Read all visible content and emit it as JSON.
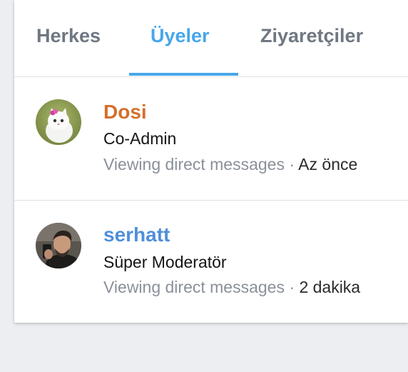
{
  "tabs": {
    "everyone": "Herkes",
    "members": "Üyeler",
    "visitors": "Ziyaretçiler",
    "active": "members"
  },
  "members": [
    {
      "name": "Dosi",
      "name_color": "#d56f2c",
      "role": "Co-Admin",
      "activity": "Viewing direct messages",
      "separator": "·",
      "time": "Az önce",
      "avatar_icon": "white-kitten-avatar"
    },
    {
      "name": "serhatt",
      "name_color": "#4f8fd9",
      "role": "Süper Moderatör",
      "activity": "Viewing direct messages",
      "separator": "·",
      "time": "2 dakika",
      "avatar_icon": "man-selfie-avatar"
    }
  ],
  "colors": {
    "accent": "#47a7eb",
    "tab_inactive": "#6f7782",
    "muted_text": "#8a9099",
    "background": "#eceef1"
  }
}
